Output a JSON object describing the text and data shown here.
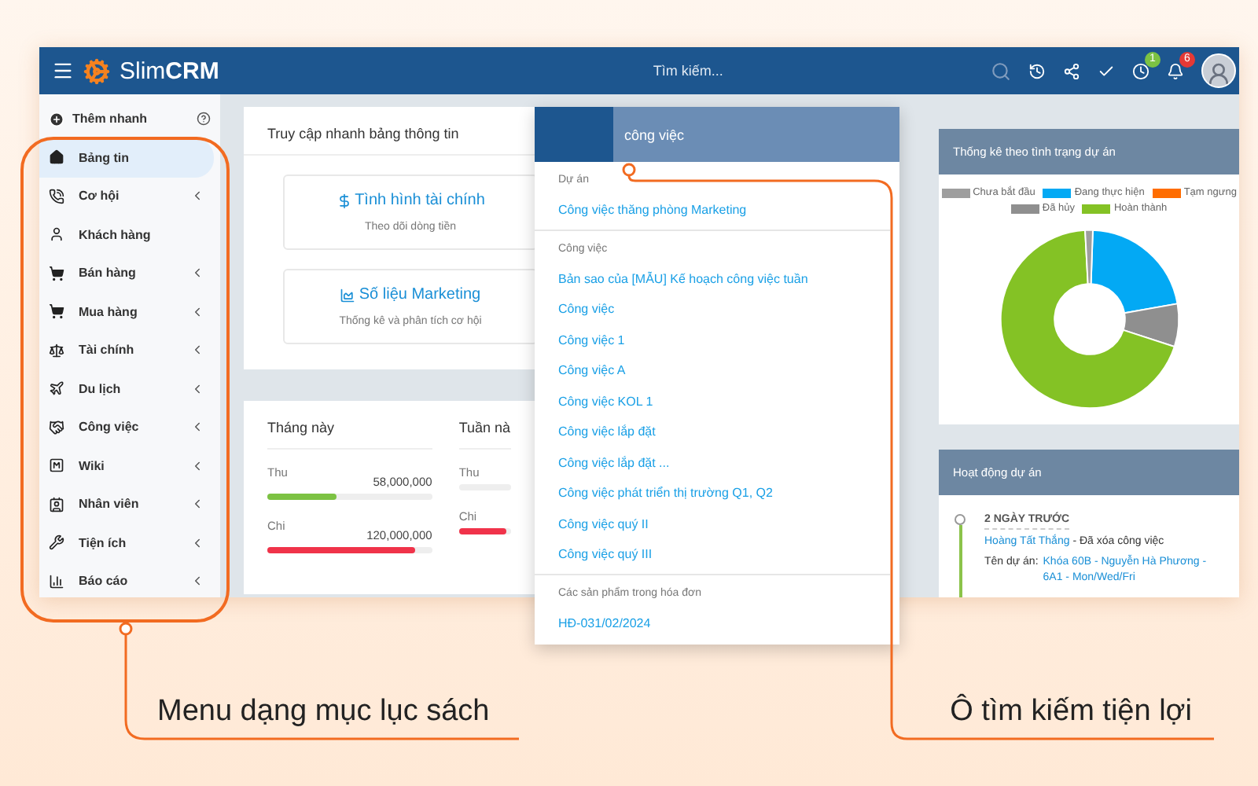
{
  "header": {
    "logo": "Slim**CRM**",
    "search_placeholder": "Tìm kiếm...",
    "notifications": [
      {
        "count": "1",
        "color": "#7cc243"
      },
      {
        "count": "6",
        "color": "#e53935"
      }
    ]
  },
  "sidebar": {
    "quick_add": "Thêm nhanh",
    "items": [
      {
        "label": "Bảng tin",
        "selected": true,
        "has_submenu": false
      },
      {
        "label": "Cơ hội",
        "selected": false,
        "has_submenu": true
      },
      {
        "label": "Khách hàng",
        "selected": false,
        "has_submenu": false
      },
      {
        "label": "Bán hàng",
        "selected": false,
        "has_submenu": true
      },
      {
        "label": "Mua hàng",
        "selected": false,
        "has_submenu": true
      },
      {
        "label": "Tài chính",
        "selected": false,
        "has_submenu": true
      },
      {
        "label": "Du lịch",
        "selected": false,
        "has_submenu": true
      },
      {
        "label": "Công việc",
        "selected": false,
        "has_submenu": true
      },
      {
        "label": "Wiki",
        "selected": false,
        "has_submenu": true
      },
      {
        "label": "Nhân viên",
        "selected": false,
        "has_submenu": true
      },
      {
        "label": "Tiện ích",
        "selected": false,
        "has_submenu": true
      },
      {
        "label": "Báo cáo",
        "selected": false,
        "has_submenu": true
      }
    ]
  },
  "quick_access": {
    "title": "Truy cập nhanh bảng thông tin",
    "links": [
      {
        "title": "Tình hình tài chính",
        "subtitle": "Theo dõi dòng tiền"
      },
      {
        "title": "Số liệu Marketing",
        "subtitle": "Thống kê và phân tích cơ hội"
      }
    ]
  },
  "finance": {
    "columns": [
      {
        "title": "Tháng này",
        "rows": [
          {
            "label": "Thu",
            "reading": "58,000,000",
            "level": 0.42,
            "color": "#7cc243"
          },
          {
            "label": "Chi",
            "reading": "120,000,000",
            "level": 0.9,
            "color": "#f0334a"
          }
        ]
      },
      {
        "title": "Tuần nà",
        "rows": [
          {
            "label": "Thu"
          },
          {
            "label": "Chi",
            "level": 0.9,
            "color": "#f0334a"
          }
        ]
      }
    ]
  },
  "search_dropdown": {
    "query": "công việc",
    "groups": [
      {
        "heading": "Dự án",
        "results": [
          "Công việc thăng phòng Marketing"
        ]
      },
      {
        "heading": "Công việc",
        "results": [
          "Bản sao của [MẪU] Kế hoạch công việc tuần",
          "Công việc",
          "Công việc 1",
          "Công việc A",
          "Công việc KOL 1",
          "Công việc lắp đặt",
          "Công việc lắp đặt ...",
          "Công việc phát triển thị trường Q1, Q2",
          "Công việc quý II",
          "Công việc quý III"
        ]
      },
      {
        "heading": "Các sản phẩm trong hóa đơn",
        "results": [
          "HĐ-031/02/2024"
        ]
      }
    ]
  },
  "status_chart": {
    "title": "Thống kê theo tình trạng dự án",
    "legend": [
      {
        "label": "Chưa bắt đầu",
        "color": "#9e9e9e"
      },
      {
        "label": "Đang thực hiện",
        "color": "#03a9f4"
      },
      {
        "label": "Tạm ngưng",
        "color": "#ff6d00"
      },
      {
        "label": "Đã hủy",
        "color": "#8f8f8f"
      },
      {
        "label": "Hoàn thành",
        "color": "#84c225"
      }
    ]
  },
  "activity": {
    "title": "Hoạt động dự án",
    "entries": [
      {
        "time": "2 NGÀY TRƯỚC",
        "user": "Hoàng Tất Thắng",
        "action": "- Đã xóa công việc",
        "project_label": "Tên dự án:",
        "project": "Khóa 60B - Nguyễn Hà Phương - 6A1 - Mon/Wed/Fri"
      }
    ]
  },
  "annotations": [
    {
      "text": "Menu dạng mục lục sách"
    },
    {
      "text": "Ô tìm kiếm tiện lợi"
    }
  ]
}
